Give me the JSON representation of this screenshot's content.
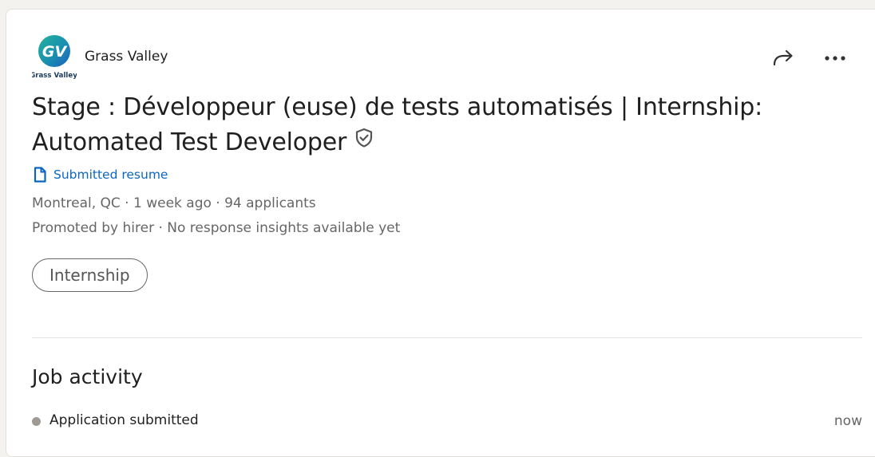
{
  "company": {
    "name": "Grass Valley",
    "logo_text": "Grass Valley",
    "logo_letters": "GV"
  },
  "actions": {
    "share_icon": "share-arrow-icon",
    "more_icon": "ellipsis-icon"
  },
  "job": {
    "title": "Stage : Développeur (euse) de tests automatisés | Internship: Automated Test Developer",
    "verified_icon": "verified-shield-icon",
    "status_label": "Submitted resume",
    "meta_line_1": "Montreal, QC · 1 week ago · 94 applicants",
    "meta_line_2": "Promoted by hirer · No response insights available yet",
    "workplace_type": "Internship"
  },
  "activity": {
    "heading": "Job activity",
    "items": [
      {
        "label": "Application submitted",
        "time": "now"
      }
    ]
  },
  "colors": {
    "link_blue": "#0a66c2",
    "text_primary": "#1f1f1f",
    "text_secondary": "#666666",
    "logo_teal": "#1aa08c",
    "logo_blue": "#1565c0"
  }
}
